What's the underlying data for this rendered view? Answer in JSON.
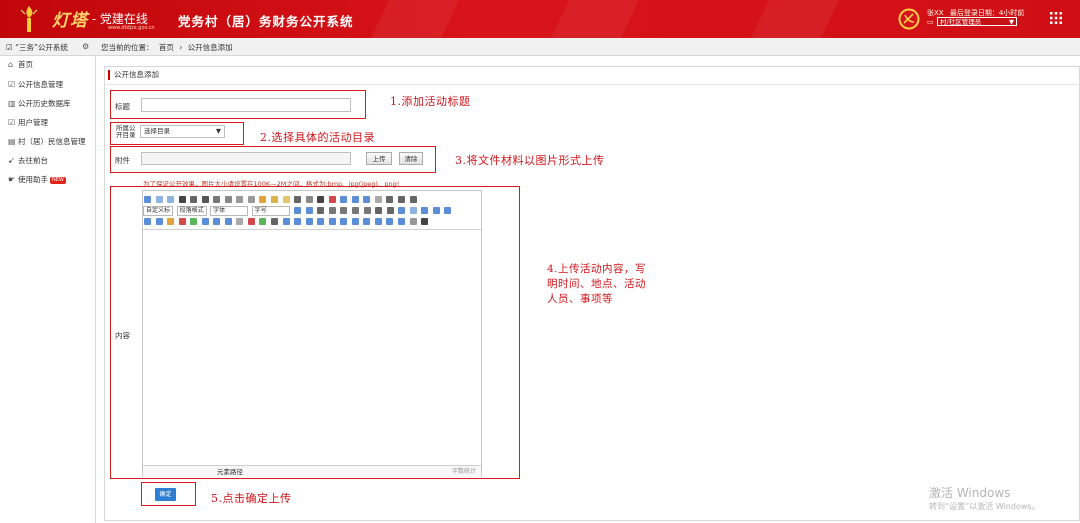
{
  "header": {
    "brand": "灯塔",
    "brand_sub": "党建在线",
    "brand_url": "www.dtdjzx.gov.cn",
    "app_title": "党务村（居）务财务公开系统",
    "user_name": "张XX",
    "last_login": "最后登录日期：4小时前",
    "role_select": "村/社区管理员",
    "emblem_color": "#d4141a",
    "accent_gold": "#ffd46a"
  },
  "subbar": {
    "system_name": "“三务”公开系统",
    "breadcrumb_prefix": "您当前的位置：",
    "breadcrumb_home": "首页",
    "breadcrumb_sep": "›",
    "breadcrumb_current": "公开信息添加"
  },
  "sidebar": {
    "items": [
      {
        "label": "首页",
        "icon": "home-icon"
      },
      {
        "label": "公开信息管理",
        "icon": "edit-icon"
      },
      {
        "label": "公开历史数据库",
        "icon": "trash-icon"
      },
      {
        "label": "用户管理",
        "icon": "edit-icon"
      },
      {
        "label": "村（居）民信息管理",
        "icon": "doc-icon"
      },
      {
        "label": "去往前台",
        "icon": "pointer-icon"
      },
      {
        "label": "使用助手",
        "icon": "hand-icon",
        "badge": "NEW"
      }
    ]
  },
  "form": {
    "panel_title": "公开信息添加",
    "title_label": "标题",
    "title_value": "",
    "category_label_line1": "所属公",
    "category_label_line2": "开目录",
    "category_value": "选择目录",
    "attachment_label": "附件",
    "upload_label": "上传",
    "clear_label": "清除",
    "hint": "为了保证公开效果，图片大小请设置在100K—2M之间，格式为:bmp、jpg(jpeg)、png!",
    "content_label": "内容",
    "editor_select_1": "自定义标",
    "editor_select_2": "段落格式",
    "editor_select_3": "字体",
    "editor_select_4": "字号",
    "element_path": "元素路径",
    "word_count": "字数统计",
    "confirm_label": "确定"
  },
  "annotations": {
    "a1": "1.添加活动标题",
    "a2": "2.选择具体的活动目录",
    "a3": "3.将文件材料以图片形式上传",
    "a4_line1": "4.上传活动内容，写",
    "a4_line2": "明时间、地点、活动",
    "a4_line3": "人员、事项等",
    "a5": "5.点击确定上传"
  },
  "watermark": {
    "line1": "激活 Windows",
    "line2": "转到“设置”以激活 Windows。"
  }
}
